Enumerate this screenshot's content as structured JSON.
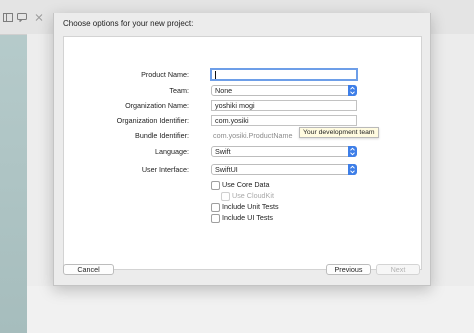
{
  "dialog": {
    "title": "Choose options for your new project:",
    "fields": {
      "product_name": {
        "label": "Product Name:",
        "value": ""
      },
      "team": {
        "label": "Team:",
        "value": "None"
      },
      "organization_name": {
        "label": "Organization Name:",
        "value": "yoshiki mogi"
      },
      "organization_identifier": {
        "label": "Organization Identifier:",
        "value": "com.yosiki"
      },
      "bundle_identifier": {
        "label": "Bundle Identifier:",
        "value": "com.yosiki.ProductName"
      },
      "language": {
        "label": "Language:",
        "value": "Swift"
      },
      "user_interface": {
        "label": "User Interface:",
        "value": "SwiftUI"
      }
    },
    "tooltip": "Your development team",
    "checkboxes": [
      {
        "label": "Use Core Data",
        "checked": false,
        "enabled": true
      },
      {
        "label": "Use CloudKit",
        "checked": false,
        "enabled": false
      },
      {
        "label": "Include Unit Tests",
        "checked": false,
        "enabled": true
      },
      {
        "label": "Include UI Tests",
        "checked": false,
        "enabled": true
      }
    ],
    "buttons": {
      "cancel": "Cancel",
      "previous": "Previous",
      "next": "Next"
    }
  },
  "colors": {
    "accent": "#3d7ee8",
    "focus_ring": "#6d9ee8",
    "tooltip_bg": "#fffbe0"
  }
}
